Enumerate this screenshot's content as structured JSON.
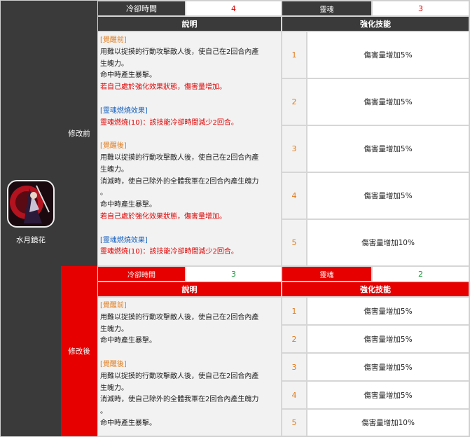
{
  "skill": {
    "name": "水月鏡花",
    "icon": "skill-portrait-icon"
  },
  "before": {
    "section_label": "修改前",
    "cooldown_label": "冷卻時間",
    "cooldown_value": "4",
    "soul_label": "靈魂",
    "soul_value": "3",
    "desc_header": "說明",
    "enhance_header": "強化技能",
    "desc": {
      "pre_title": "[覺醒前]",
      "pre_l1": "用難以捉摸的行動攻擊敵人後，使自己在2回合內產",
      "pre_l2": "生魄力。",
      "pre_l3": "命中時產生暴擊。",
      "pre_l4": "若自己處於強化效果狀態，傷害量增加。",
      "burn1_title": "[靈魂燃燒效果]",
      "burn1_line": "靈魂燃燒(10)：該技能冷卻時間減少2回合。",
      "post_title": "[覺醒後]",
      "post_l1": "用難以捉摸的行動攻擊敵人後，使自己在2回合內產",
      "post_l2": "生魄力。",
      "post_l3": "消滅時，使自己除外的全體我軍在2回合內產生魄力",
      "post_l4": "。",
      "post_l5": "命中時產生暴擊。",
      "post_l6": "若自己處於強化效果狀態，傷害量增加。",
      "burn2_title": "[靈魂燃燒效果]",
      "burn2_line": "靈魂燃燒(10)：該技能冷卻時間減少2回合。"
    },
    "levels": [
      {
        "num": "1",
        "text": "傷害量增加5%"
      },
      {
        "num": "2",
        "text": "傷害量增加5%"
      },
      {
        "num": "3",
        "text": "傷害量增加5%"
      },
      {
        "num": "4",
        "text": "傷害量增加5%"
      },
      {
        "num": "5",
        "text": "傷害量增加10%"
      }
    ]
  },
  "after": {
    "section_label": "修改後",
    "cooldown_label": "冷卻時間",
    "cooldown_value": "3",
    "soul_label": "靈魂",
    "soul_value": "2",
    "desc_header": "說明",
    "enhance_header": "強化技能",
    "desc": {
      "pre_title": "[覺醒前]",
      "pre_l1": "用難以捉摸的行動攻擊敵人後，使自己在2回合內產",
      "pre_l2": "生魄力。",
      "pre_l3": "命中時產生暴擊。",
      "post_title": "[覺醒後]",
      "post_l1": "用難以捉摸的行動攻擊敵人後，使自己在2回合內產",
      "post_l2": "生魄力。",
      "post_l3": "消滅時，使自己除外的全體我軍在2回合內產生魄力",
      "post_l4": "。",
      "post_l5": "命中時產生暴擊。"
    },
    "levels": [
      {
        "num": "1",
        "text": "傷害量增加5%"
      },
      {
        "num": "2",
        "text": "傷害量增加5%"
      },
      {
        "num": "3",
        "text": "傷害量增加5%"
      },
      {
        "num": "4",
        "text": "傷害量增加5%"
      },
      {
        "num": "5",
        "text": "傷害量增加10%"
      }
    ]
  },
  "colors": {
    "dark": "#3a3a3a",
    "red": "#e60000",
    "orange": "#e07b1a",
    "blue": "#1560bd",
    "green": "#1a9a3a"
  }
}
